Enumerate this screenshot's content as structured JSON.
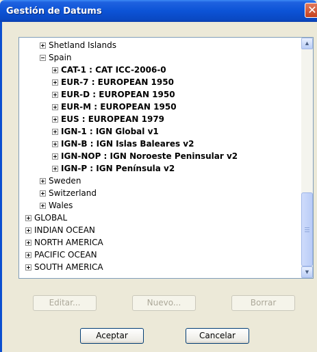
{
  "window": {
    "title": "Gestión de Datums",
    "close_label": "✕"
  },
  "tree": {
    "nodes": [
      {
        "label": "Shetland Islands",
        "expanded": false,
        "bold": false
      },
      {
        "label": "Spain",
        "expanded": true,
        "bold": false
      },
      {
        "label": "CAT-1 : CAT ICC-2006-0",
        "expanded": false,
        "bold": true
      },
      {
        "label": "EUR-7 : EUROPEAN 1950",
        "expanded": false,
        "bold": true
      },
      {
        "label": "EUR-D : EUROPEAN 1950",
        "expanded": false,
        "bold": true
      },
      {
        "label": "EUR-M : EUROPEAN 1950",
        "expanded": false,
        "bold": true
      },
      {
        "label": "EUS : EUROPEAN 1979",
        "expanded": false,
        "bold": true
      },
      {
        "label": "IGN-1 : IGN Global v1",
        "expanded": false,
        "bold": true
      },
      {
        "label": "IGN-B : IGN Islas Baleares v2",
        "expanded": false,
        "bold": true
      },
      {
        "label": "IGN-NOP : IGN Noroeste Peninsular v2",
        "expanded": false,
        "bold": true
      },
      {
        "label": "IGN-P : IGN Península v2",
        "expanded": false,
        "bold": true
      },
      {
        "label": "Sweden",
        "expanded": false,
        "bold": false
      },
      {
        "label": "Switzerland",
        "expanded": false,
        "bold": false
      },
      {
        "label": "Wales",
        "expanded": false,
        "bold": false
      },
      {
        "label": "GLOBAL",
        "expanded": false,
        "bold": false
      },
      {
        "label": "INDIAN OCEAN",
        "expanded": false,
        "bold": false
      },
      {
        "label": "NORTH AMERICA",
        "expanded": false,
        "bold": false
      },
      {
        "label": "PACIFIC OCEAN",
        "expanded": false,
        "bold": false
      },
      {
        "label": "SOUTH AMERICA",
        "expanded": false,
        "bold": false
      }
    ]
  },
  "scrollbar": {
    "up_icon": "chevron-up-icon",
    "down_icon": "chevron-down-icon",
    "up_label": "▲",
    "down_label": "▼"
  },
  "buttons": {
    "edit": {
      "label": "Editar...",
      "enabled": false
    },
    "new": {
      "label": "Nuevo...",
      "enabled": false
    },
    "delete": {
      "label": "Borrar",
      "enabled": false
    },
    "accept": {
      "label": "Aceptar",
      "enabled": true
    },
    "cancel": {
      "label": "Cancelar",
      "enabled": true
    }
  },
  "colors": {
    "titlebar": "#0a48c2",
    "dialog_bg": "#ece9d8",
    "close_button": "#c3411f",
    "tree_border": "#7f9db9"
  }
}
